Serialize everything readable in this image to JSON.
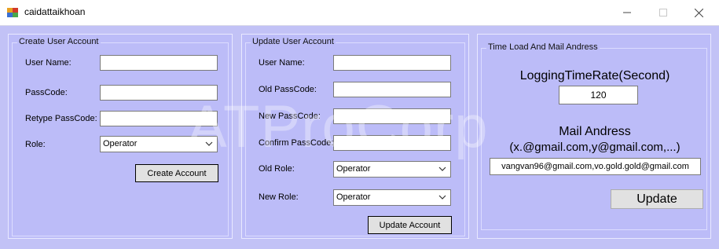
{
  "window": {
    "title": "caidattaikhoan",
    "watermark": "ATProCorp"
  },
  "create_account": {
    "group_title": "Create User Account",
    "username_label": "User Name:",
    "username_value": "",
    "passcode_label": "PassCode:",
    "passcode_value": "",
    "retype_label": "Retype PassCode:",
    "retype_value": "",
    "role_label": "Role:",
    "role_value": "Operator",
    "button_label": "Create Account"
  },
  "update_account": {
    "group_title": "Update User Account",
    "username_label": "User Name:",
    "username_value": "",
    "old_passcode_label": "Old PassCode:",
    "old_passcode_value": "",
    "new_passcode_label": "New PassCode:",
    "new_passcode_value": "",
    "confirm_passcode_label": "Confirm PassCode:",
    "confirm_passcode_value": "",
    "old_role_label": "Old Role:",
    "old_role_value": "Operator",
    "new_role_label": "New Role:",
    "new_role_value": "Operator",
    "button_label": "Update Account"
  },
  "settings": {
    "group_title": "Time Load And Mail Andress",
    "logging_label": "LoggingTimeRate(Second)",
    "logging_value": "120",
    "mail_label": "Mail Andress",
    "mail_hint": "(x.@gmail.com,y@gmail.com,...)",
    "mail_value": "vangvan96@gmail.com,vo.gold.gold@gmail.com",
    "button_label": "Update"
  },
  "colors": {
    "form_background": "#c2c2f6",
    "panel_background": "#bcbcf8"
  },
  "icons": {
    "app": "app-icon",
    "minimize": "minimize-icon",
    "maximize": "maximize-icon",
    "close": "close-icon",
    "dropdown": "chevron-down-icon"
  }
}
